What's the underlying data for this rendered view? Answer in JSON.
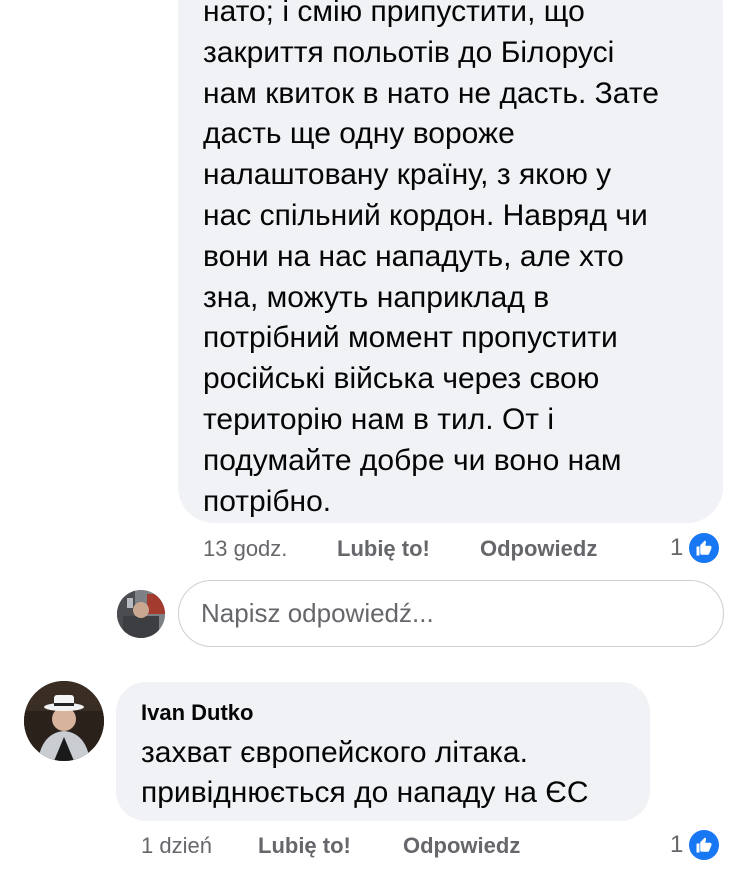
{
  "comments": [
    {
      "text": "нато; і смію припустити, що\nзакриття польотів до Білорусі\nнам квиток в нато не дасть. Зате\nдасть ще одну вороже\nналаштовану країну, з якою у\nнас спільний кордон. Навряд чи\nвони на нас нападуть, але хто\nзна, можуть наприклад в\nпотрібний момент пропустити\nросійські війська через свою\nтериторію нам в тил. От і\nподумайте добре чи воно нам\nпотрібно.",
      "time": "13 godz.",
      "like_label": "Lubię to!",
      "reply_label": "Odpowiedz",
      "reaction_count": "1",
      "reaction_icon": "thumbs-up-icon"
    },
    {
      "author": "Ivan Dutko",
      "text": "захват європейского літака.\nпривіднюється до нападу на ЄС",
      "time": "1 dzień",
      "like_label": "Lubię to!",
      "reply_label": "Odpowiedz",
      "reaction_count": "1",
      "reaction_icon": "thumbs-up-icon"
    }
  ],
  "reply_box": {
    "placeholder": "Napisz odpowiedź..."
  },
  "colors": {
    "bubble": "#f0f2f5",
    "meta_text": "#65676b",
    "like_blue": "#1877f2"
  }
}
